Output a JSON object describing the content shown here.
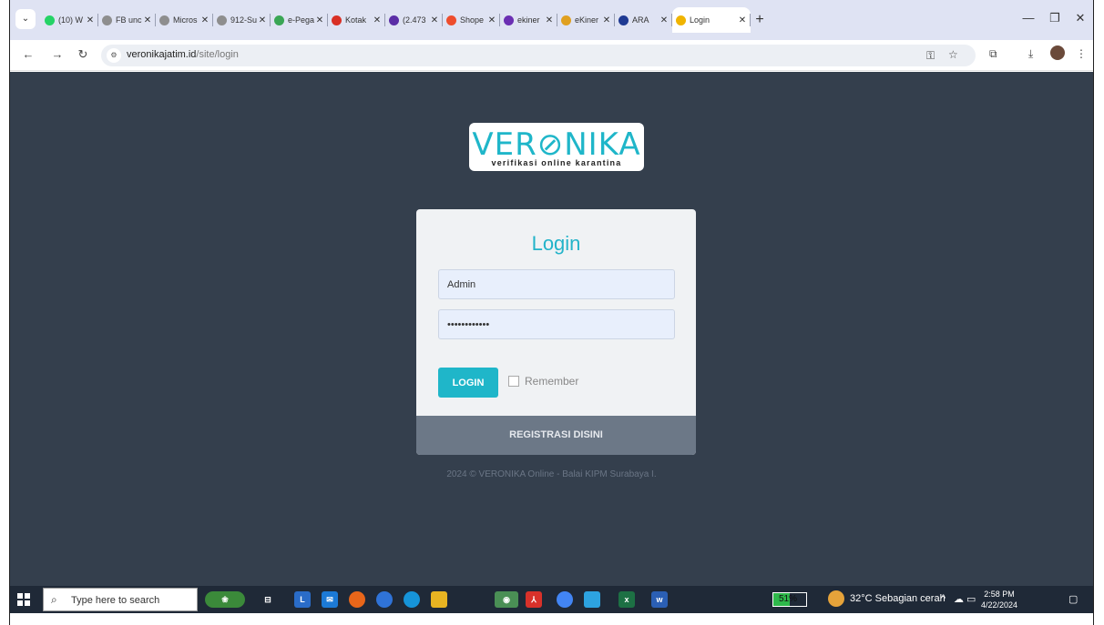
{
  "browser": {
    "tabs": [
      {
        "label": "(10) W",
        "icon": "whatsapp-icon",
        "color": "#25d366"
      },
      {
        "label": "FB unc",
        "icon": "globe-icon",
        "color": "#8e8e8e"
      },
      {
        "label": "Micros",
        "icon": "globe-icon",
        "color": "#8e8e8e"
      },
      {
        "label": "912-Su",
        "icon": "globe-icon",
        "color": "#8e8e8e"
      },
      {
        "label": "e-Pega",
        "icon": "globe-icon",
        "color": "#3aa655"
      },
      {
        "label": "Kotak",
        "icon": "gmail-icon",
        "color": "#d93025"
      },
      {
        "label": "(2.473",
        "icon": "mail-icon",
        "color": "#5b2ea6"
      },
      {
        "label": "Shope",
        "icon": "shopee-icon",
        "color": "#ee4d2d"
      },
      {
        "label": "ekiner",
        "icon": "ekinerja-icon",
        "color": "#6b2fb3"
      },
      {
        "label": "eKiner",
        "icon": "ekinerja-icon",
        "color": "#e0a020"
      },
      {
        "label": "ARA",
        "icon": "ara-icon",
        "color": "#1f3a93"
      },
      {
        "label": "Login",
        "icon": "login-favicon-icon",
        "color": "#f0b400",
        "active": true
      }
    ],
    "url_host": "veronikajatim.id",
    "url_path": "/site/login"
  },
  "page": {
    "logo_word": "VER⊘NIKA",
    "logo_tagline": "verifikasi online karantina",
    "login_title": "Login",
    "username_value": "Admin",
    "password_value": "••••••••••••",
    "login_button": "LOGIN",
    "remember_label": "Remember",
    "register_label": "REGISTRASI DISINI",
    "footer": "2024 © VERONIKA Online - Balai KIPM Surabaya I.",
    "colors": {
      "accent": "#1fb6c9",
      "background": "#343f4d"
    }
  },
  "taskbar": {
    "search_placeholder": "Type here to search",
    "battery": "51%",
    "battery_level": 0.51,
    "weather": "32°C  Sebagian cerah",
    "time": "2:58 PM",
    "date": "4/22/2024"
  }
}
